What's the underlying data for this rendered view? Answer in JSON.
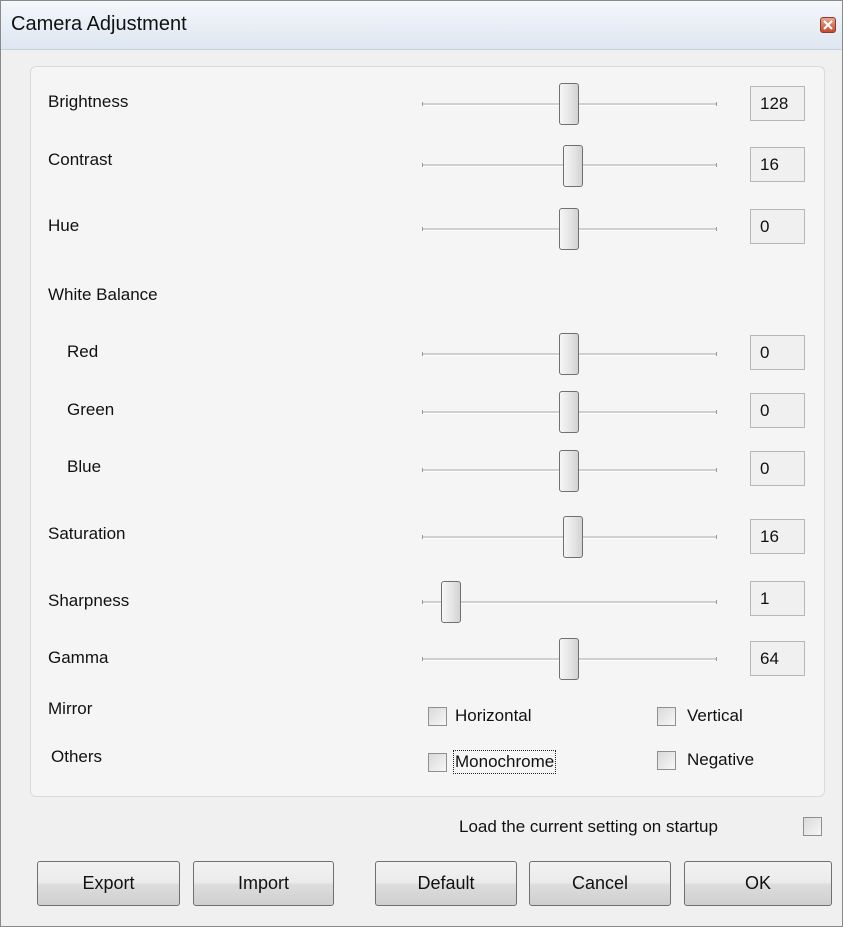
{
  "window": {
    "title": "Camera Adjustment"
  },
  "sliders": {
    "brightness": {
      "label": "Brightness",
      "value": "128"
    },
    "contrast": {
      "label": "Contrast",
      "value": "16"
    },
    "hue": {
      "label": "Hue",
      "value": "0"
    },
    "white_balance_heading": "White Balance",
    "red": {
      "label": "Red",
      "value": "0"
    },
    "green": {
      "label": "Green",
      "value": "0"
    },
    "blue": {
      "label": "Blue",
      "value": "0"
    },
    "saturation": {
      "label": "Saturation",
      "value": "16"
    },
    "sharpness": {
      "label": "Sharpness",
      "value": "1"
    },
    "gamma": {
      "label": "Gamma",
      "value": "64"
    }
  },
  "mirror": {
    "label": "Mirror",
    "horizontal": {
      "label": "Horizontal",
      "checked": false
    },
    "vertical": {
      "label": "Vertical",
      "checked": false
    }
  },
  "others": {
    "label": "Others",
    "monochrome": {
      "label": "Monochrome",
      "checked": false
    },
    "negative": {
      "label": "Negative",
      "checked": false
    }
  },
  "startup": {
    "label": "Load the current setting on startup",
    "checked": false
  },
  "buttons": {
    "export": "Export",
    "import": "Import",
    "default": "Default",
    "cancel": "Cancel",
    "ok": "OK"
  },
  "icons": {
    "close": "close-icon"
  }
}
